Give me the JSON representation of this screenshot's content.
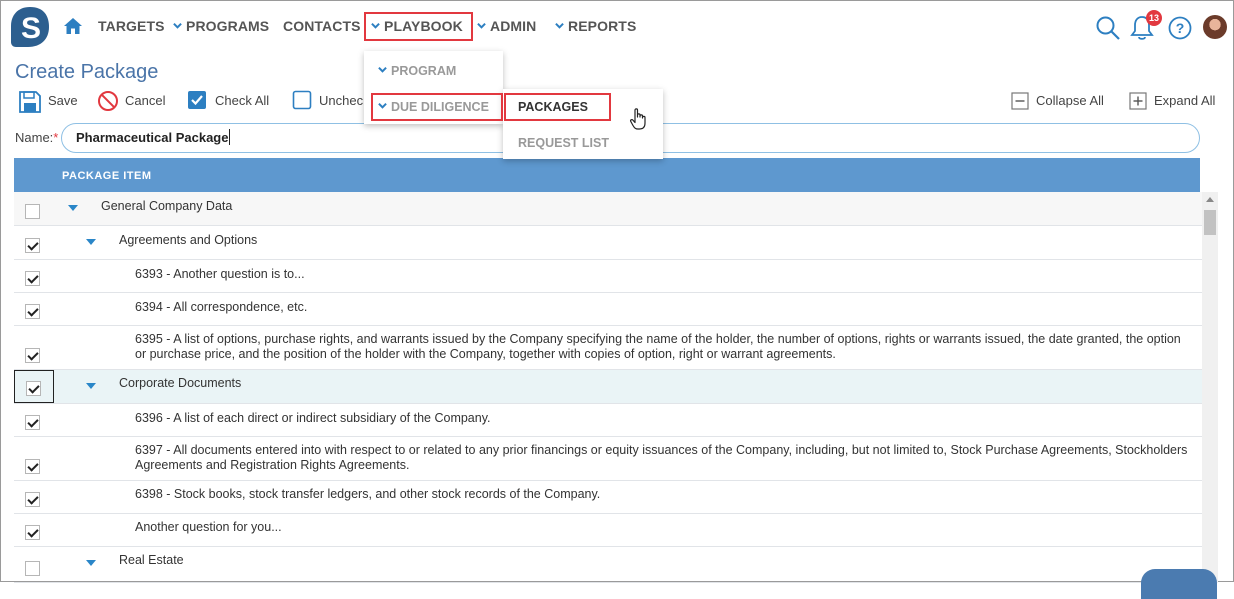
{
  "nav": {
    "items": [
      "TARGETS",
      "PROGRAMS",
      "CONTACTS",
      "PLAYBOOK",
      "ADMIN",
      "REPORTS"
    ],
    "notification_count": "13"
  },
  "playbook_menu": {
    "items": [
      "PROGRAM",
      "DUE DILIGENCE"
    ],
    "submenu": [
      "PACKAGES",
      "REQUEST LIST"
    ]
  },
  "page": {
    "title": "Create Package",
    "toolbar": {
      "save": "Save",
      "cancel": "Cancel",
      "check_all": "Check All",
      "uncheck_all": "Uncheck",
      "collapse_all": "Collapse All",
      "expand_all": "Expand All"
    },
    "name_label": "Name:",
    "name_required": "*",
    "name_value": "Pharmaceutical Package"
  },
  "grid": {
    "header": "PACKAGE ITEM",
    "rows": [
      {
        "level": 0,
        "expandable": true,
        "checked": false,
        "text": "General Company Data"
      },
      {
        "level": 1,
        "expandable": true,
        "checked": true,
        "text": "Agreements and Options"
      },
      {
        "level": 2,
        "expandable": false,
        "checked": true,
        "text": "6393 - Another question is to..."
      },
      {
        "level": 2,
        "expandable": false,
        "checked": true,
        "text": "6394 - All correspondence, etc."
      },
      {
        "level": 2,
        "expandable": false,
        "checked": true,
        "text": "6395 - A list of options, purchase rights, and warrants issued by the Company specifying the name of the holder, the number of options, rights or warrants issued, the date granted, the option or purchase price, and the position of the holder with the Company, together with copies of option, right or warrant agreements."
      },
      {
        "level": 1,
        "expandable": true,
        "checked": true,
        "text": "Corporate Documents"
      },
      {
        "level": 2,
        "expandable": false,
        "checked": true,
        "text": "6396 - A list of each direct or indirect subsidiary of the Company."
      },
      {
        "level": 2,
        "expandable": false,
        "checked": true,
        "text": "6397 - All documents entered into with respect to or related to any prior financings or equity issuances of the Company, including, but not limited to, Stock Purchase Agreements, Stockholders Agreements and Registration Rights Agreements."
      },
      {
        "level": 2,
        "expandable": false,
        "checked": true,
        "text": "6398 - Stock books, stock transfer ledgers, and other stock records of the Company."
      },
      {
        "level": 2,
        "expandable": false,
        "checked": true,
        "text": "Another question for you..."
      },
      {
        "level": 1,
        "expandable": true,
        "checked": false,
        "text": "Real Estate"
      }
    ]
  },
  "colors": {
    "accent": "#5e98cf",
    "title": "#4a74a8",
    "highlight_box": "#e2383f",
    "tree_arrow": "#2a86c8"
  }
}
